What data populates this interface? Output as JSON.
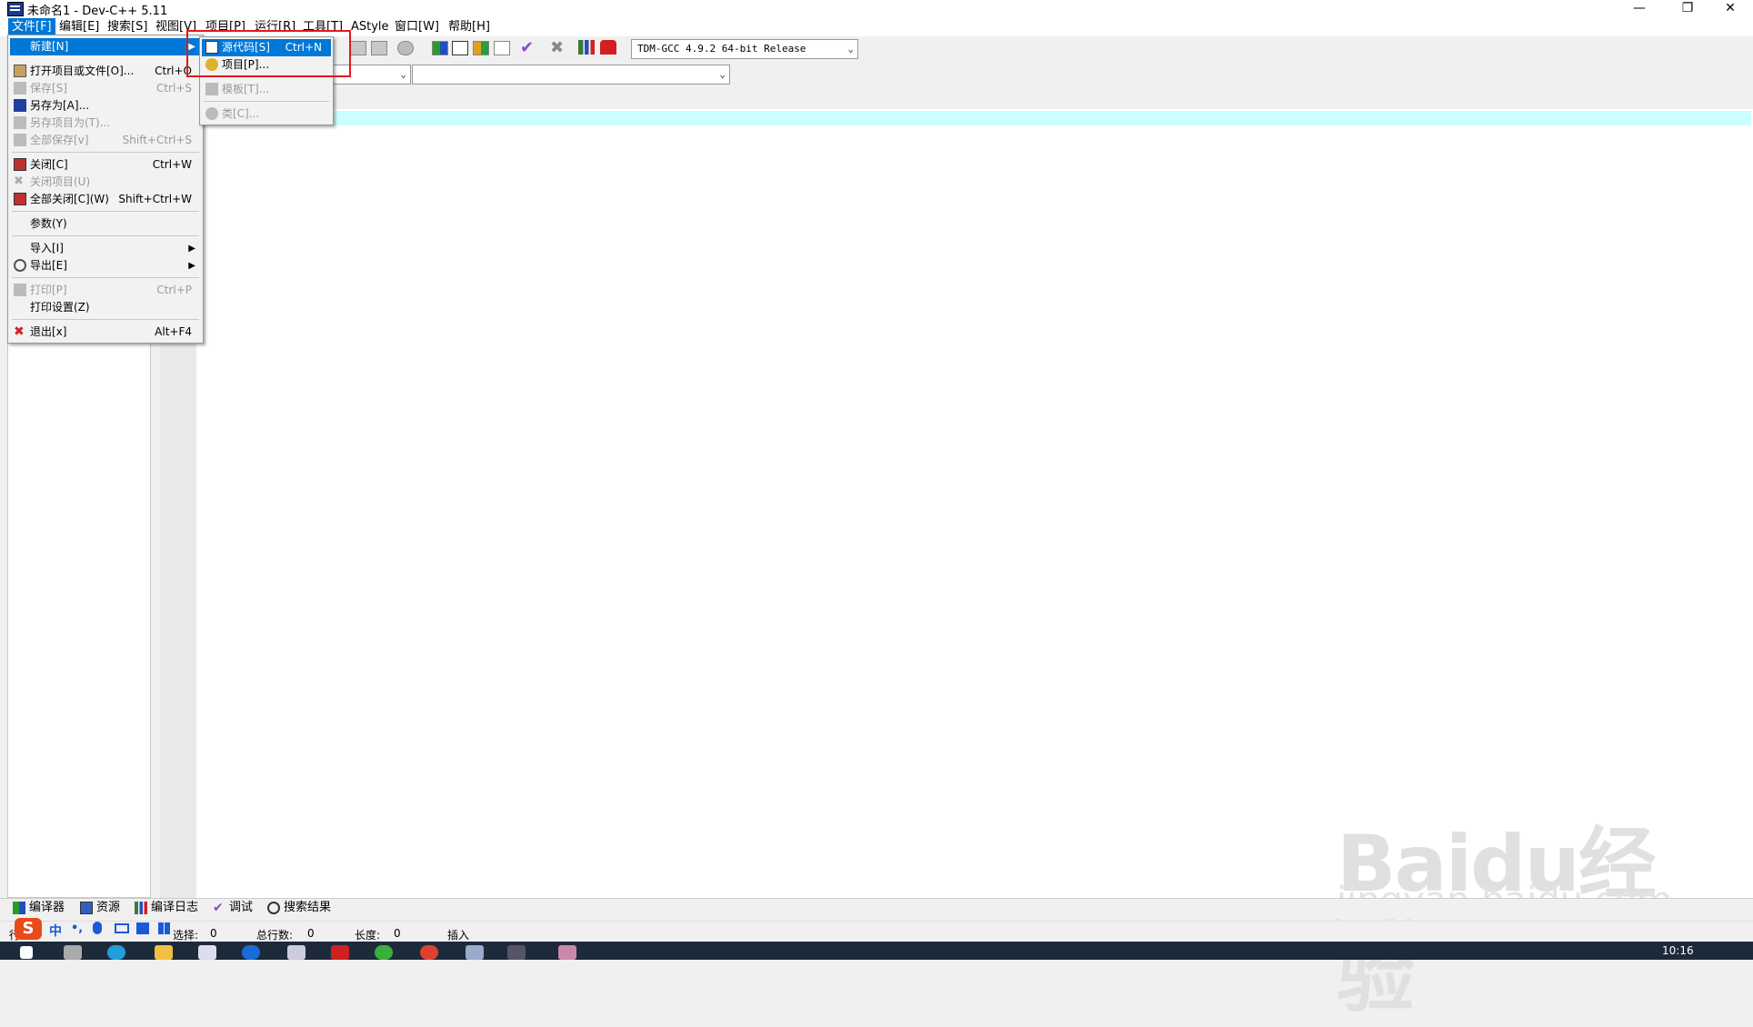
{
  "window": {
    "title": "未命名1 - Dev-C++ 5.11",
    "controls": {
      "minimize": "—",
      "maximize": "❐",
      "close": "✕"
    }
  },
  "menubar": {
    "items": [
      "文件[F]",
      "编辑[E]",
      "搜索[S]",
      "视图[V]",
      "项目[P]",
      "运行[R]",
      "工具[T]",
      "AStyle",
      "窗口[W]",
      "帮助[H]"
    ],
    "active_index": 0
  },
  "toolbar": {
    "compiler_select": "TDM-GCC 4.9.2 64-bit Release",
    "class_select": "",
    "member_select": ""
  },
  "file_menu": {
    "items": [
      {
        "label": "新建[N]",
        "shortcut": "",
        "submenu": true,
        "highlighted": true,
        "disabled": false,
        "icon": ""
      },
      {
        "label": "打开项目或文件[O]...",
        "shortcut": "Ctrl+O",
        "disabled": false,
        "icon": "open-icon"
      },
      {
        "label": "保存[S]",
        "shortcut": "Ctrl+S",
        "disabled": true,
        "icon": "save-icon"
      },
      {
        "label": "另存为[A]...",
        "shortcut": "",
        "disabled": false,
        "icon": "save-as-icon"
      },
      {
        "label": "另存项目为(T)...",
        "shortcut": "",
        "disabled": true,
        "icon": "save-project-icon"
      },
      {
        "label": "全部保存[v]",
        "shortcut": "Shift+Ctrl+S",
        "disabled": true,
        "icon": "save-all-icon"
      },
      {
        "label": "关闭[C]",
        "shortcut": "Ctrl+W",
        "disabled": false,
        "icon": "close-file-icon"
      },
      {
        "label": "关闭项目(U)",
        "shortcut": "",
        "disabled": true,
        "icon": "close-project-icon"
      },
      {
        "label": "全部关闭[C](W)",
        "shortcut": "Shift+Ctrl+W",
        "disabled": false,
        "icon": "close-all-icon"
      },
      {
        "label": "参数(Y)",
        "shortcut": "",
        "disabled": false,
        "icon": ""
      },
      {
        "label": "导入[I]",
        "shortcut": "",
        "submenu": true,
        "disabled": false,
        "icon": ""
      },
      {
        "label": "导出[E]",
        "shortcut": "",
        "submenu": true,
        "disabled": false,
        "icon": "export-icon"
      },
      {
        "label": "打印[P]",
        "shortcut": "Ctrl+P",
        "disabled": true,
        "icon": "print-icon"
      },
      {
        "label": "打印设置(Z)",
        "shortcut": "",
        "disabled": false,
        "icon": ""
      },
      {
        "label": "退出[x]",
        "shortcut": "Alt+F4",
        "disabled": false,
        "icon": "exit-icon"
      }
    ]
  },
  "new_submenu": {
    "items": [
      {
        "label": "源代码[S]",
        "shortcut": "Ctrl+N",
        "highlighted": true,
        "disabled": false,
        "icon": "source-file-icon"
      },
      {
        "label": "项目[P]...",
        "shortcut": "",
        "disabled": false,
        "icon": "project-icon"
      },
      {
        "label": "模板[T]...",
        "shortcut": "",
        "disabled": true,
        "icon": "template-icon"
      },
      {
        "label": "类[C]...",
        "shortcut": "",
        "disabled": true,
        "icon": "class-icon"
      }
    ]
  },
  "bottom_tabs": [
    "编译器",
    "资源",
    "编译日志",
    "调试",
    "搜索结果"
  ],
  "statusbar": {
    "row_label_prefix": "行",
    "selection_label": "选择:",
    "selection_value": "0",
    "total_lines_label": "总行数:",
    "total_lines_value": "0",
    "length_label": "长度:",
    "length_value": "0",
    "mode": "插入"
  },
  "ime": {
    "mode": "中",
    "punct": "•,"
  },
  "taskbar": {
    "clock": "10:16"
  },
  "watermark": {
    "logo": "Baidu经验",
    "url": "jingyan.baidu.com"
  },
  "colors": {
    "menu_highlight": "#0078d7",
    "current_line": "#ccffff",
    "annotation_box": "#e0191e"
  }
}
